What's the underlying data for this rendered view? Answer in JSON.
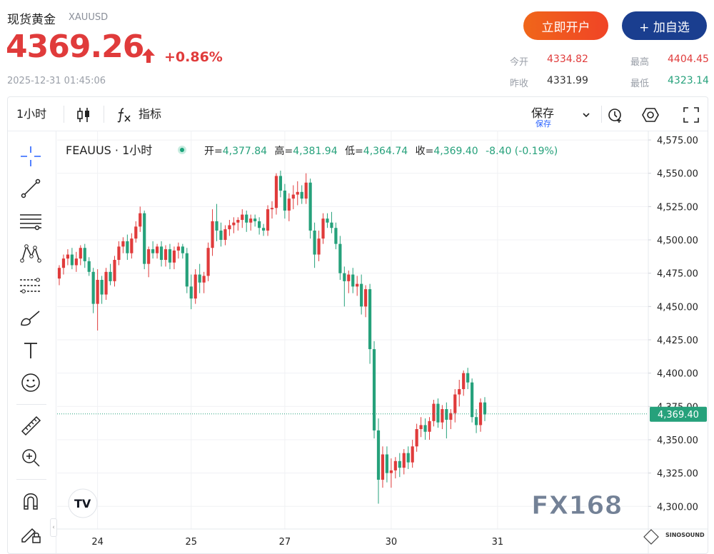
{
  "header": {
    "name": "现货黄金",
    "symbol": "XAUUSD",
    "price": "4369.26",
    "change_pct": "+0.86%",
    "datetime": "2025-12-31 01:45:06",
    "btn_open": "立即开户",
    "btn_watch": "+ 加自选",
    "quotes": [
      {
        "label": "今开",
        "value": "4334.82"
      },
      {
        "label": "最高",
        "value": "4404.45"
      },
      {
        "label": "昨收",
        "value": "4331.99"
      },
      {
        "label": "最低",
        "value": "4323.14"
      }
    ],
    "colors": {
      "up": "#e03b3b",
      "down": "#26a17b"
    }
  },
  "toolbar": {
    "interval": "1小时",
    "indicators": "指标",
    "save": "保存",
    "save_sub": "保存",
    "icons": [
      "candle-chart-icon",
      "fx-icon",
      "alert-icon",
      "settings-hex-icon",
      "fullscreen-icon"
    ]
  },
  "left_tools": [
    "crosshair-icon",
    "trend-line-icon",
    "horizontal-lines-icon",
    "pattern-icon",
    "fib-icon",
    "brush-icon",
    "text-icon",
    "emoji-icon",
    "ruler-icon",
    "zoom-in-icon",
    "magnet-icon",
    "lock-pencil-icon"
  ],
  "legend": {
    "symbol": "FEAUUS · 1小时",
    "open_label": "开=",
    "open": "4,377.84",
    "high_label": "高=",
    "high": "4,381.94",
    "low_label": "低=",
    "low": "4,364.74",
    "close_label": "收=",
    "close": "4,369.40",
    "change": "-8.40 (-0.19%)"
  },
  "watermark": {
    "brand": "FX168",
    "corner": "SINOSOUND"
  },
  "chart_data": {
    "type": "candlestick",
    "y_ticks": [
      4575,
      4550,
      4525,
      4500,
      4475,
      4450,
      4425,
      4400,
      4375,
      4350,
      4325,
      4300
    ],
    "y_tick_labels": [
      "4,575.00",
      "4,550.00",
      "4,525.00",
      "4,500.00",
      "4,475.00",
      "4,450.00",
      "4,425.00",
      "4,400.00",
      "4,375.00",
      "4,350.00",
      "4,325.00",
      "4,300.00"
    ],
    "ylim": [
      4283,
      4582
    ],
    "x_labels": [
      {
        "label": "24",
        "index": 9
      },
      {
        "label": "25",
        "index": 31
      },
      {
        "label": "27",
        "index": 53
      },
      {
        "label": "30",
        "index": 78
      },
      {
        "label": "31",
        "index": 103
      }
    ],
    "last_price": 4369.4,
    "last_price_label": "4,369.40",
    "candles": [
      [
        4471,
        4481,
        4466,
        4479
      ],
      [
        4479,
        4489,
        4474,
        4486
      ],
      [
        4486,
        4493,
        4481,
        4489
      ],
      [
        4489,
        4494,
        4478,
        4481
      ],
      [
        4481,
        4491,
        4476,
        4486
      ],
      [
        4486,
        4496,
        4481,
        4494
      ],
      [
        4494,
        4497,
        4479,
        4484
      ],
      [
        4484,
        4487,
        4473,
        4476
      ],
      [
        4476,
        4479,
        4445,
        4452
      ],
      [
        4452,
        4478,
        4432,
        4470
      ],
      [
        4470,
        4473,
        4452,
        4459
      ],
      [
        4459,
        4479,
        4455,
        4476
      ],
      [
        4476,
        4482,
        4466,
        4469
      ],
      [
        4469,
        4488,
        4465,
        4485
      ],
      [
        4485,
        4499,
        4481,
        4495
      ],
      [
        4495,
        4502,
        4490,
        4499
      ],
      [
        4499,
        4504,
        4485,
        4490
      ],
      [
        4490,
        4505,
        4486,
        4501
      ],
      [
        4501,
        4514,
        4498,
        4510
      ],
      [
        4510,
        4525,
        4506,
        4520
      ],
      [
        4520,
        4522,
        4478,
        4482
      ],
      [
        4482,
        4495,
        4472,
        4493
      ],
      [
        4493,
        4499,
        4486,
        4490
      ],
      [
        4490,
        4497,
        4486,
        4495
      ],
      [
        4495,
        4499,
        4480,
        4485
      ],
      [
        4485,
        4496,
        4480,
        4493
      ],
      [
        4493,
        4497,
        4478,
        4483
      ],
      [
        4483,
        4495,
        4478,
        4492
      ],
      [
        4492,
        4498,
        4486,
        4495
      ],
      [
        4495,
        4497,
        4486,
        4490
      ],
      [
        4490,
        4494,
        4460,
        4465
      ],
      [
        4465,
        4474,
        4448,
        4456
      ],
      [
        4456,
        4478,
        4452,
        4474
      ],
      [
        4474,
        4482,
        4460,
        4468
      ],
      [
        4468,
        4476,
        4460,
        4473
      ],
      [
        4473,
        4498,
        4469,
        4494
      ],
      [
        4494,
        4523,
        4488,
        4514
      ],
      [
        4514,
        4527,
        4499,
        4507
      ],
      [
        4507,
        4513,
        4495,
        4500
      ],
      [
        4500,
        4511,
        4496,
        4508
      ],
      [
        4508,
        4515,
        4503,
        4511
      ],
      [
        4511,
        4517,
        4505,
        4513
      ],
      [
        4513,
        4517,
        4507,
        4515
      ],
      [
        4515,
        4523,
        4509,
        4519
      ],
      [
        4519,
        4522,
        4506,
        4513
      ],
      [
        4513,
        4519,
        4507,
        4516
      ],
      [
        4516,
        4519,
        4510,
        4514
      ],
      [
        4514,
        4517,
        4504,
        4509
      ],
      [
        4509,
        4512,
        4503,
        4507
      ],
      [
        4507,
        4526,
        4503,
        4523
      ],
      [
        4523,
        4529,
        4516,
        4524
      ],
      [
        4524,
        4550,
        4519,
        4548
      ],
      [
        4548,
        4552,
        4532,
        4537
      ],
      [
        4537,
        4542,
        4516,
        4522
      ],
      [
        4522,
        4535,
        4514,
        4531
      ],
      [
        4531,
        4541,
        4523,
        4534
      ],
      [
        4534,
        4544,
        4526,
        4536
      ],
      [
        4536,
        4541,
        4527,
        4531
      ],
      [
        4531,
        4550,
        4527,
        4543
      ],
      [
        4543,
        4546,
        4501,
        4507
      ],
      [
        4507,
        4513,
        4479,
        4489
      ],
      [
        4489,
        4507,
        4484,
        4501
      ],
      [
        4501,
        4520,
        4497,
        4516
      ],
      [
        4516,
        4520,
        4509,
        4513
      ],
      [
        4513,
        4521,
        4505,
        4509
      ],
      [
        4509,
        4513,
        4493,
        4497
      ],
      [
        4497,
        4503,
        4470,
        4475
      ],
      [
        4475,
        4480,
        4450,
        4469
      ],
      [
        4469,
        4477,
        4460,
        4474
      ],
      [
        4474,
        4479,
        4460,
        4465
      ],
      [
        4465,
        4473,
        4458,
        4467
      ],
      [
        4467,
        4474,
        4444,
        4450
      ],
      [
        4450,
        4466,
        4442,
        4463
      ],
      [
        4463,
        4467,
        4407,
        4418
      ],
      [
        4418,
        4424,
        4351,
        4357
      ],
      [
        4357,
        4366,
        4302,
        4320
      ],
      [
        4320,
        4345,
        4314,
        4339
      ],
      [
        4339,
        4345,
        4318,
        4325
      ],
      [
        4325,
        4336,
        4314,
        4327
      ],
      [
        4327,
        4337,
        4321,
        4334
      ],
      [
        4334,
        4340,
        4322,
        4329
      ],
      [
        4329,
        4343,
        4324,
        4340
      ],
      [
        4340,
        4345,
        4328,
        4333
      ],
      [
        4333,
        4350,
        4329,
        4345
      ],
      [
        4345,
        4362,
        4341,
        4358
      ],
      [
        4358,
        4367,
        4352,
        4361
      ],
      [
        4361,
        4366,
        4350,
        4356
      ],
      [
        4356,
        4367,
        4350,
        4364
      ],
      [
        4364,
        4380,
        4360,
        4377
      ],
      [
        4377,
        4381,
        4359,
        4363
      ],
      [
        4363,
        4376,
        4358,
        4373
      ],
      [
        4373,
        4378,
        4351,
        4365
      ],
      [
        4365,
        4373,
        4358,
        4370
      ],
      [
        4370,
        4388,
        4363,
        4384
      ],
      [
        4384,
        4395,
        4375,
        4388
      ],
      [
        4388,
        4402,
        4383,
        4400
      ],
      [
        4400,
        4404,
        4388,
        4393
      ],
      [
        4393,
        4396,
        4363,
        4367
      ],
      [
        4367,
        4373,
        4355,
        4361
      ],
      [
        4361,
        4381,
        4356,
        4378
      ],
      [
        4378,
        4382,
        4364,
        4369
      ]
    ]
  }
}
